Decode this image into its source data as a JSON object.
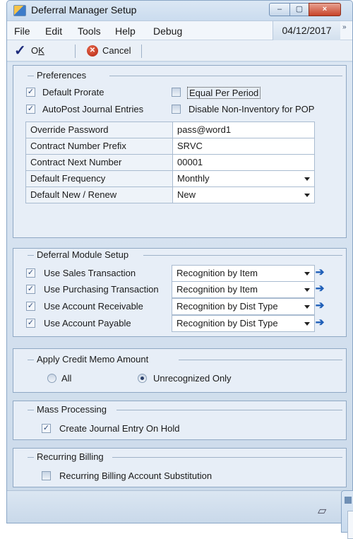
{
  "window": {
    "title": "Deferral Manager Setup",
    "close_glyph": "×",
    "min_glyph": "–",
    "max_glyph": "▢"
  },
  "menu": {
    "items": [
      "File",
      "Edit",
      "Tools",
      "Help",
      "Debug"
    ],
    "date": "04/12/2017",
    "more": "»"
  },
  "toolbar": {
    "ok_prefix": "O",
    "ok_underline": "K",
    "cancel_label": "Cancel"
  },
  "preferences": {
    "title": "Preferences",
    "default_prorate": {
      "label": "Default Prorate",
      "checked": true
    },
    "equal_per_period": {
      "label": "Equal Per Period",
      "checked": false
    },
    "autopost": {
      "label": "AutoPost Journal Entries",
      "checked": true
    },
    "disable_noninventory": {
      "label": "Disable Non-Inventory for POP",
      "checked": false
    },
    "fields": [
      {
        "label": "Override Password",
        "value": "pass@word1",
        "dropdown": false
      },
      {
        "label": "Contract Number Prefix",
        "value": "SRVC",
        "dropdown": false
      },
      {
        "label": "Contract Next Number",
        "value": "00001",
        "dropdown": false
      },
      {
        "label": "Default  Frequency",
        "value": "Monthly",
        "dropdown": true
      },
      {
        "label": "Default New / Renew",
        "value": "New",
        "dropdown": true
      }
    ]
  },
  "deferral": {
    "title": "Deferral Module Setup",
    "rows": [
      {
        "label": "Use Sales Transaction",
        "value": "Recognition by Item",
        "checked": true
      },
      {
        "label": "Use Purchasing Transaction",
        "value": "Recognition by Item",
        "checked": true
      },
      {
        "label": "Use Account Receivable",
        "value": "Recognition by Dist Type",
        "checked": true
      },
      {
        "label": "Use Account Payable",
        "value": "Recognition by Dist Type",
        "checked": true
      }
    ]
  },
  "credit_memo": {
    "title": "Apply Credit Memo Amount",
    "options": [
      "All",
      "Unrecognized Only"
    ],
    "selected": "Unrecognized Only"
  },
  "mass": {
    "title": "Mass Processing",
    "label": "Create Journal Entry On Hold",
    "checked": true
  },
  "recurring": {
    "title": "Recurring Billing",
    "label": "Recurring Billing Account Substitution",
    "checked": false
  },
  "colors": {
    "accent_arrow": "#1f5fb8",
    "close_red": "#c7442a",
    "panel_bg": "#e7eef7"
  }
}
